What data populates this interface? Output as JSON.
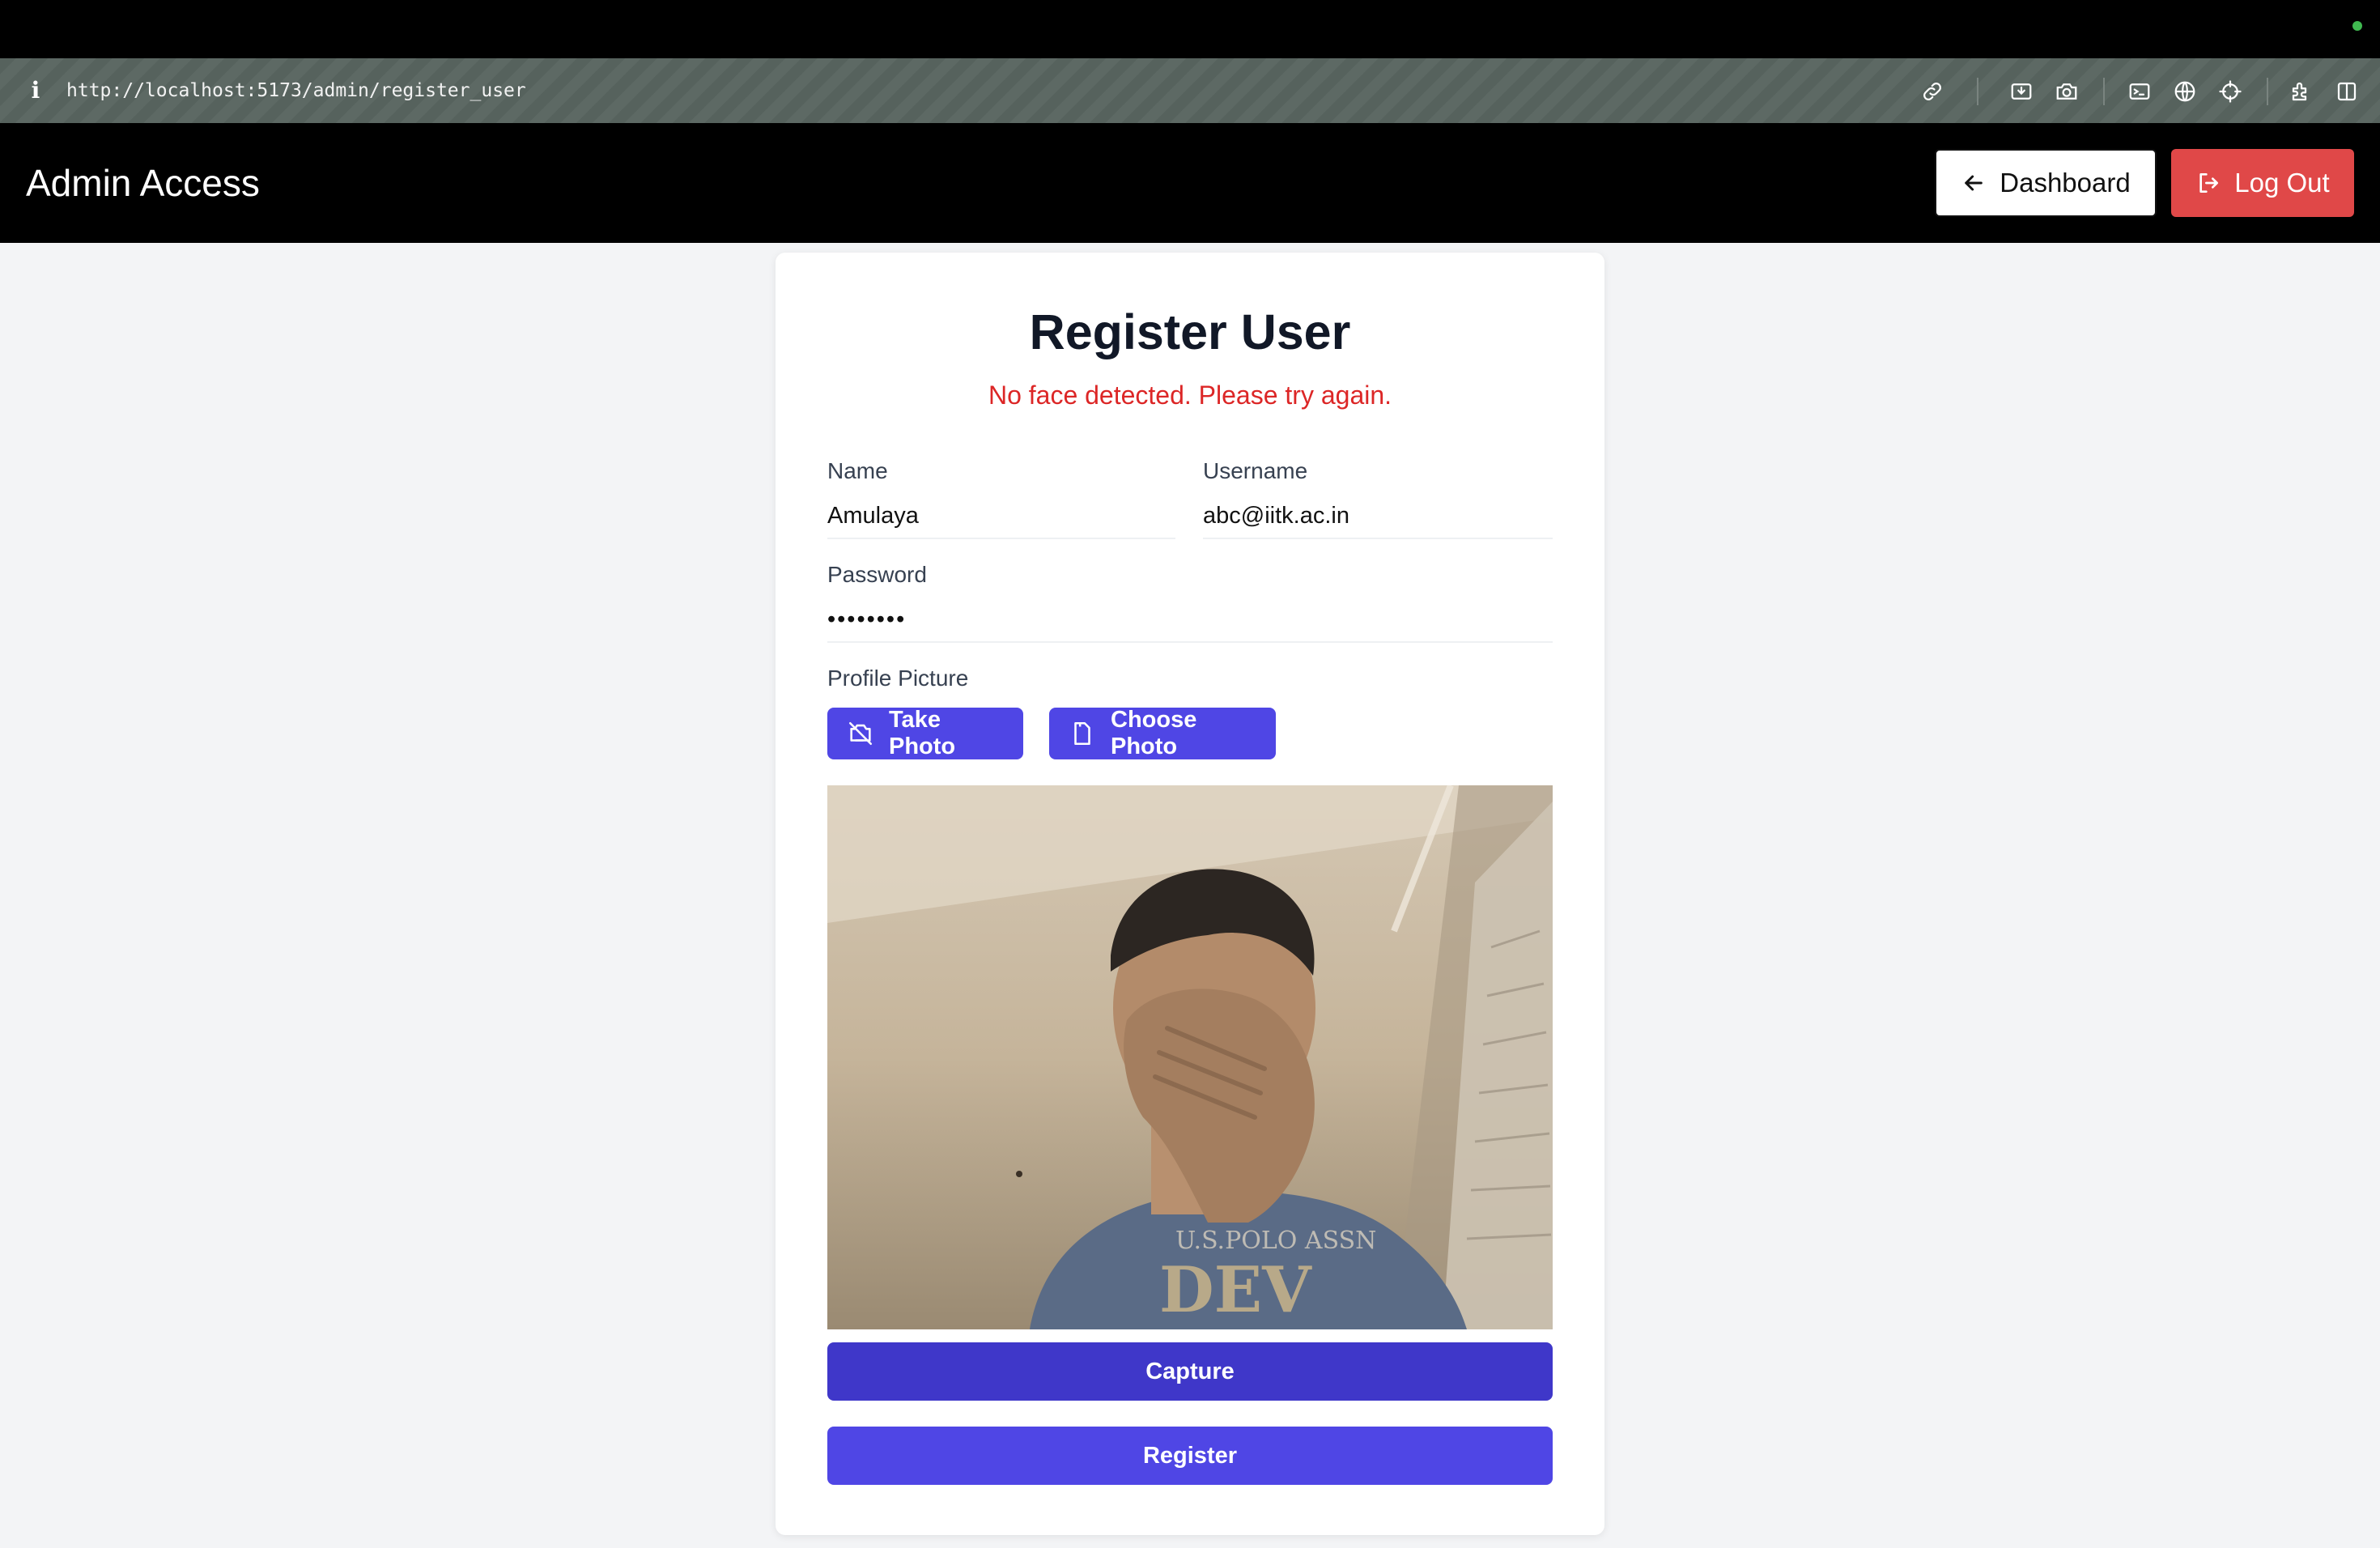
{
  "browser": {
    "url": "http://localhost:5173/admin/register_user",
    "toolbar_icons": [
      "link-icon",
      "download-icon",
      "camera-icon",
      "terminal-icon",
      "globe-icon",
      "crosshair-icon",
      "extensions-icon",
      "sidebar-icon"
    ]
  },
  "header": {
    "brand": "Admin Access",
    "dashboard_label": "Dashboard",
    "logout_label": "Log Out",
    "logout_color": "#e04848"
  },
  "form": {
    "title": "Register User",
    "error_message": "No face detected. Please try again.",
    "name_label": "Name",
    "name_value": "Amulaya",
    "username_label": "Username",
    "username_value": "abc@iitk.ac.in",
    "password_label": "Password",
    "password_value": "••••••••",
    "profile_label": "Profile Picture",
    "take_photo_label": "Take Photo",
    "choose_photo_label": "Choose Photo",
    "capture_label": "Capture",
    "register_label": "Register",
    "accent_color": "#4f46e5",
    "error_color": "#dc2626"
  }
}
